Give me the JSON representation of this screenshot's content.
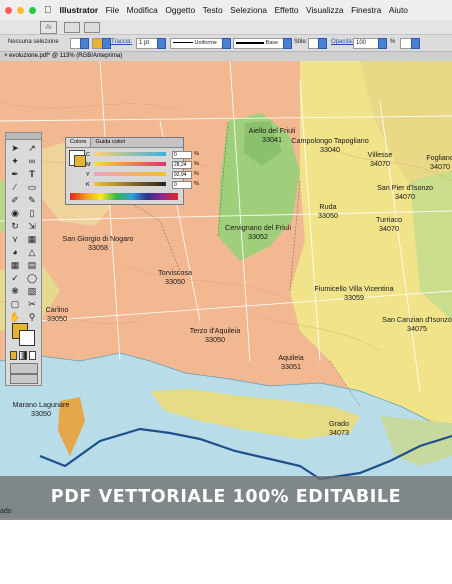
{
  "menubar": {
    "app_name": "Illustrator",
    "items": [
      "File",
      "Modifica",
      "Oggetto",
      "Testo",
      "Seleziona",
      "Effetto",
      "Visualizza",
      "Finestra",
      "Aiuto"
    ]
  },
  "control_bar": {
    "selection": "Nessuna selezione",
    "stroke_label": "Traccia:",
    "stroke_weight": "1 pt",
    "uniform": "Uniforme",
    "base": "Base",
    "style_label": "Stile:",
    "opacity_label": "Opacità:",
    "opacity_value": "100",
    "opacity_unit": "%"
  },
  "document_tab": {
    "title": "evoluzione.pdf* @ 113% (RGB/Anteprima)"
  },
  "color_panel": {
    "tabs": [
      "Colore",
      "Guida colori"
    ],
    "channels": [
      {
        "label": "C",
        "value": "0"
      },
      {
        "label": "M",
        "value": "28,24"
      },
      {
        "label": "Y",
        "value": "92,94"
      },
      {
        "label": "K",
        "value": "0"
      }
    ],
    "unit": "%"
  },
  "map_labels": [
    {
      "name": "Aiello del Friuli",
      "code": "33041"
    },
    {
      "name": "Campolongo Tapogliano",
      "code": "33040"
    },
    {
      "name": "Villesse",
      "code": "34070"
    },
    {
      "name": "Fogliano",
      "code": "34070"
    },
    {
      "name": "San Pier d'Isonzo",
      "code": "34070"
    },
    {
      "name": "Ruda",
      "code": "33050"
    },
    {
      "name": "Turriaco",
      "code": "34070"
    },
    {
      "name": "Cervignano del Friuli",
      "code": "33052"
    },
    {
      "name": "San Giorgio di Nogaro",
      "code": "33058"
    },
    {
      "name": "Torviscosa",
      "code": "33050"
    },
    {
      "name": "Fiumicello Villa Vicentina",
      "code": "33059"
    },
    {
      "name": "San Canzian d'Isonzo",
      "code": "34075"
    },
    {
      "name": "Carlino",
      "code": "33050"
    },
    {
      "name": "Terzo d'Aquileia",
      "code": "33050"
    },
    {
      "name": "Aquileia",
      "code": "33051"
    },
    {
      "name": "Marano Lagunare",
      "code": "33050"
    },
    {
      "name": "Grado",
      "code": "34073"
    }
  ],
  "edge_label": "ado",
  "banner": {
    "text": "PDF VETTORIALE 100% EDITABILE"
  },
  "colors": {
    "map_orange": "#f2b892",
    "map_yellow": "#f0e38a",
    "map_green": "#9fcf7a",
    "sea": "#b9dde8",
    "coast": "#1d4f8c",
    "fill_swatch": "#e8b333"
  }
}
